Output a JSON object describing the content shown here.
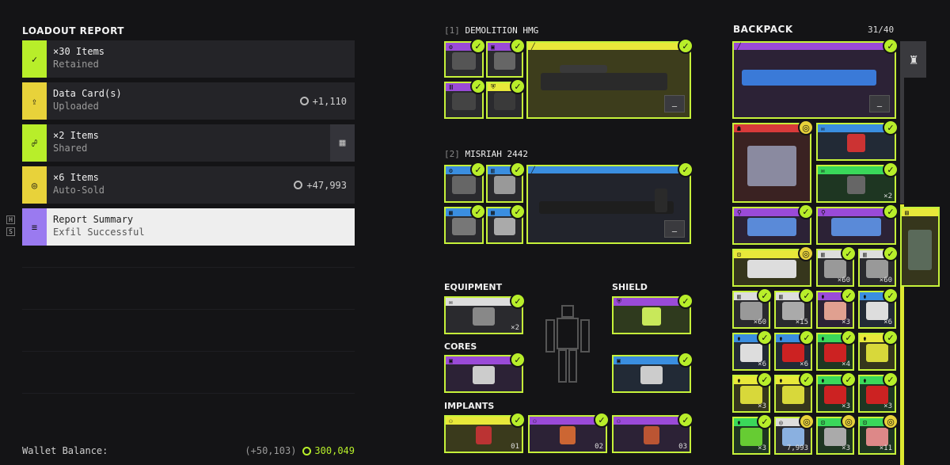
{
  "loadout": {
    "title": "LOADOUT REPORT",
    "rows": [
      {
        "line1": "×30 Items",
        "line2": "Retained",
        "icon": "check-icon",
        "color": "#b8ee2a",
        "value": ""
      },
      {
        "line1": "Data Card(s)",
        "line2": "Uploaded",
        "icon": "upload-icon",
        "color": "#e8d23a",
        "value": "+1,110"
      },
      {
        "line1": "×2 Items",
        "line2": "Shared",
        "icon": "people-icon",
        "color": "#b8ee2a",
        "value": ""
      },
      {
        "line1": "×6 Items",
        "line2": "Auto-Sold",
        "icon": "coin-icon",
        "color": "#e8d23a",
        "value": "+47,993"
      },
      {
        "line1": "Report Summary",
        "line2": "Exfil Successful",
        "icon": "list-icon",
        "color": "#9a7af0",
        "value": ""
      }
    ],
    "hotkeys": [
      "H",
      "S"
    ]
  },
  "wallet": {
    "label": "Wallet Balance:",
    "delta": "(+50,103)",
    "balance": "300,049"
  },
  "weapons": [
    {
      "index": "[1]",
      "name": "DEMOLITION HMG"
    },
    {
      "index": "[2]",
      "name": "MISRIAH 2442"
    }
  ],
  "sections": {
    "equipment": "EQUIPMENT",
    "shield": "SHIELD",
    "cores": "CORES",
    "implants": "IMPLANTS"
  },
  "backpack": {
    "title": "BACKPACK",
    "count": "31/40"
  },
  "quantities": {
    "equipment": "×2",
    "bp_grenade": "×2",
    "bp_ammo1": "×60",
    "bp_ammo2": "×60",
    "bp_r4_1": "×60",
    "bp_r4_2": "×15",
    "bp_r4_3": "×3",
    "bp_r4_4": "×6",
    "bp_r5_1": "×6",
    "bp_r5_2": "×6",
    "bp_r5_3": "×4",
    "bp_r6_1": "×3",
    "bp_r6_2": "×3",
    "bp_r6_3": "×3",
    "bp_r7_1": "×3",
    "bp_r7_2": "7,993",
    "bp_r7_3": "×3",
    "bp_r7_4": "×11"
  },
  "implant_labels": [
    "01",
    "02",
    "03"
  ],
  "colors": {
    "accent": "#b8ee2a",
    "gold": "#e8d23a",
    "purple": "#9a4ad8",
    "blue": "#3a8ee0",
    "red": "#d83a3a",
    "green": "#3ad85a"
  }
}
